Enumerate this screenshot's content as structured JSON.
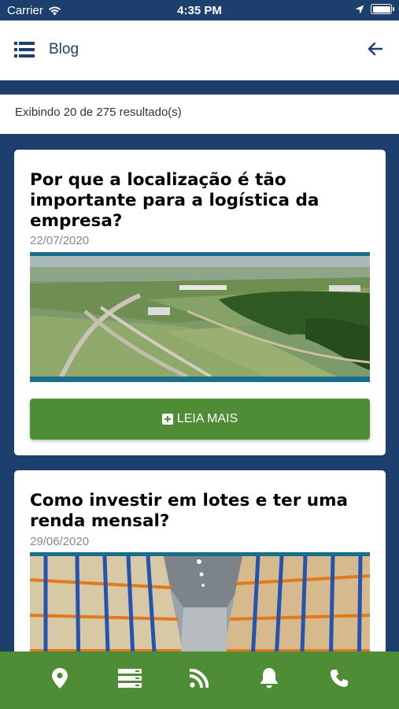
{
  "status_bar": {
    "carrier": "Carrier",
    "time": "4:35 PM"
  },
  "header": {
    "title": "Blog",
    "menu_icon": "list-icon",
    "back_icon": "arrow-left-icon"
  },
  "results": {
    "text": "Exibindo 20 de 275 resultado(s)"
  },
  "posts": [
    {
      "title": "Por que a localização é tão importante para a logística da empresa?",
      "date": "22/07/2020",
      "image": "aerial-highway-landscape",
      "button_label": "LEIA MAIS"
    },
    {
      "title": "Como investir em lotes e ter uma renda mensal?",
      "date": "29/06/2020",
      "image": "warehouse-shelves"
    }
  ],
  "tab_bar": {
    "items": [
      "map-pin-icon",
      "server-list-icon",
      "rss-icon",
      "bell-icon",
      "phone-icon"
    ]
  },
  "colors": {
    "primary": "#1d3f6e",
    "accent": "#4e8c35",
    "image_border": "#1a6e8a"
  }
}
